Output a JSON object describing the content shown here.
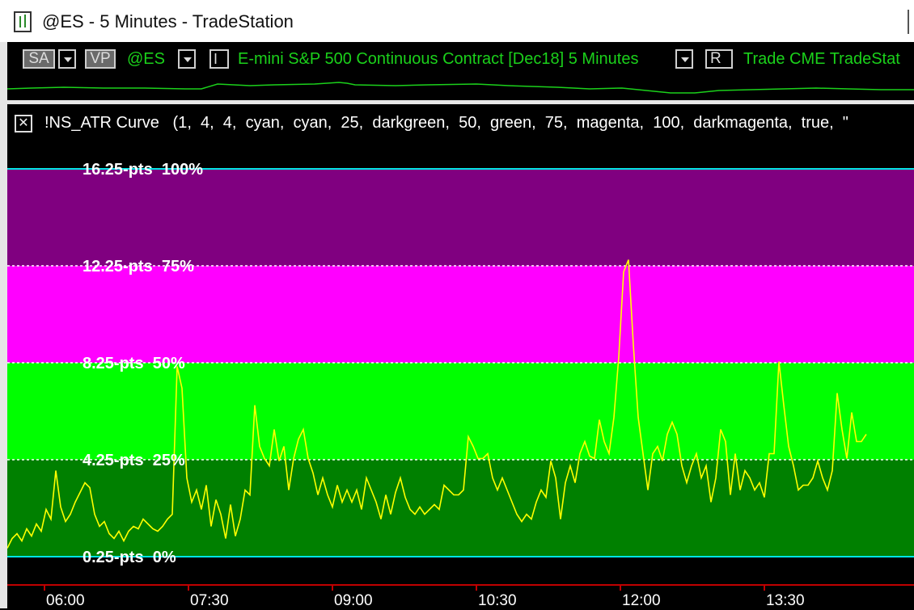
{
  "window": {
    "title": "@ES - 5 Minutes - TradeStation"
  },
  "toolbar": {
    "sa_label": "SA",
    "vp_label": "VP",
    "symbol": "@ES",
    "i_label": "I",
    "description": "E-mini S&P 500 Continuous Contract [Dec18]  5 Minutes",
    "r_label": "R",
    "trailing": "Trade  CME  TradeStat"
  },
  "indicator": {
    "close_label": "✕",
    "header": "!NS_ATR Curve   (1,  4,  4,  cyan,  cyan,  25,  darkgreen,  50,  green,  75,  magenta,  100,  darkmagenta,  true,  \""
  },
  "levels": [
    {
      "pts": "16.25-pts",
      "pct": "100%"
    },
    {
      "pts": "12.25-pts",
      "pct": "75%"
    },
    {
      "pts": "8.25-pts",
      "pct": "50%"
    },
    {
      "pts": "4.25-pts",
      "pct": "25%"
    },
    {
      "pts": "0.25-pts",
      "pct": "0%"
    }
  ],
  "time_axis": [
    "06:00",
    "07:30",
    "09:00",
    "10:30",
    "12:00",
    "13:30"
  ],
  "colors": {
    "band_100": "#800080",
    "band_75": "#ff00ff",
    "band_50": "#00ff00",
    "band_25": "#008000",
    "cyan_line": "#00e5e5",
    "atr_line": "#ffff00",
    "price_line": "#1bd11b",
    "axis": "#c00000"
  },
  "chart_data": {
    "type": "line",
    "title": "",
    "xlabel": "",
    "ylabel": "",
    "ylim": [
      0.25,
      16.25
    ],
    "x_ticks": [
      "06:00",
      "07:30",
      "09:00",
      "10:30",
      "12:00",
      "13:30"
    ],
    "series": [
      {
        "values": [
          0.6,
          1.0,
          1.2,
          0.9,
          1.4,
          1.1,
          1.6,
          1.3,
          2.2,
          1.8,
          3.8,
          2.3,
          1.7,
          2.0,
          2.5,
          2.9,
          3.3,
          3.1,
          2.0,
          1.5,
          1.7,
          1.2,
          1.0,
          1.3,
          0.9,
          1.3,
          1.5,
          1.4,
          1.8,
          1.6,
          1.4,
          1.3,
          1.5,
          1.8,
          2.0,
          8.1,
          7.2,
          3.5,
          2.5,
          3.0,
          2.2,
          3.2,
          1.5,
          2.6,
          2.0,
          1.0,
          2.4,
          1.1,
          1.8,
          3.0,
          2.8,
          6.5,
          4.8,
          4.3,
          4.0,
          5.5,
          4.2,
          4.8,
          3.0,
          4.3,
          5.1,
          5.5,
          4.3,
          3.7,
          2.8,
          3.5,
          2.8,
          2.3,
          3.2,
          2.5,
          3.0,
          2.5,
          3.0,
          2.2,
          3.5,
          3.0,
          2.5,
          1.8,
          2.8,
          2.0,
          2.9,
          3.5,
          2.7,
          2.2,
          2.0,
          2.3,
          2.0,
          2.2,
          2.4,
          2.2,
          3.2,
          3.0,
          2.8,
          2.8,
          3.0,
          5.2,
          4.8,
          4.3,
          4.3,
          4.5,
          3.5,
          3.0,
          3.5,
          3.0,
          2.5,
          2.0,
          1.7,
          2.0,
          1.8,
          2.5,
          3.0,
          2.7,
          4.2,
          3.5,
          1.8,
          3.3,
          4.0,
          3.3,
          4.5,
          5.0,
          4.4,
          4.3,
          5.9,
          5.0,
          4.5,
          6.0,
          8.5,
          12.0,
          12.5,
          9.0,
          6.0,
          4.5,
          3.0,
          4.5,
          4.8,
          4.2,
          5.3,
          5.8,
          5.3,
          4.0,
          3.3,
          4.0,
          4.5,
          3.5,
          4.0,
          2.5,
          3.5,
          5.5,
          5.0,
          2.8,
          4.5,
          3.0,
          3.8,
          3.5,
          3.0,
          3.3,
          2.7,
          4.5,
          4.5,
          8.3,
          6.5,
          4.8,
          4.0,
          3.0,
          3.2,
          3.2,
          3.5,
          4.2,
          3.5,
          3.0,
          3.8,
          7.0,
          5.5,
          4.3,
          6.2,
          5.0,
          5.0,
          5.3
        ]
      }
    ]
  }
}
